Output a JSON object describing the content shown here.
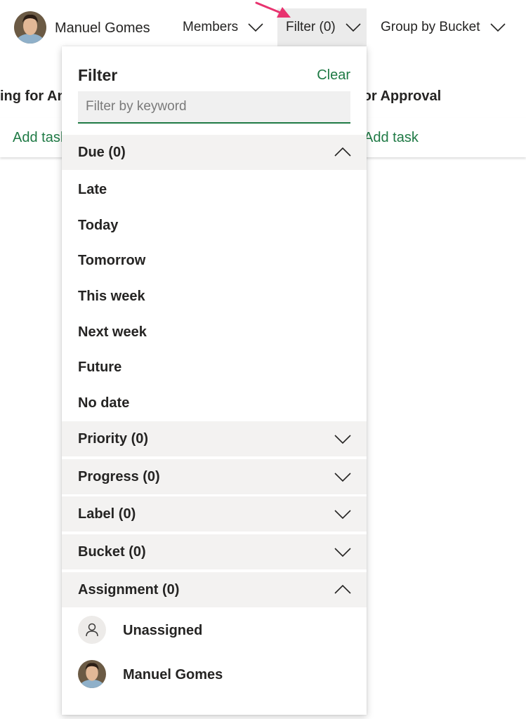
{
  "header": {
    "user_name": "Manuel Gomes",
    "members_label": "Members",
    "filter_label": "Filter (0)",
    "group_label": "Group by Bucket"
  },
  "board": {
    "left_bucket_title": "ing for An",
    "right_bucket_title": "for Approval",
    "add_task_left": "Add task",
    "add_task_right": "Add task"
  },
  "filter_panel": {
    "title": "Filter",
    "clear_label": "Clear",
    "search_placeholder": "Filter by keyword",
    "due": {
      "header": "Due (0)",
      "expanded": true,
      "items": [
        "Late",
        "Today",
        "Tomorrow",
        "This week",
        "Next week",
        "Future",
        "No date"
      ]
    },
    "priority": {
      "header": "Priority (0)",
      "expanded": false
    },
    "progress": {
      "header": "Progress (0)",
      "expanded": false
    },
    "label": {
      "header": "Label (0)",
      "expanded": false
    },
    "bucket": {
      "header": "Bucket (0)",
      "expanded": false
    },
    "assignment": {
      "header": "Assignment (0)",
      "expanded": true,
      "items": [
        {
          "name": "Unassigned",
          "icon": "person-outline-icon"
        },
        {
          "name": "Manuel Gomes",
          "icon": "avatar-photo"
        }
      ]
    }
  },
  "colors": {
    "accent_green": "#1f7a45",
    "arrow_pink": "#e8336f",
    "section_bg": "#f3f2f1",
    "button_active_bg": "#ebebeb"
  }
}
